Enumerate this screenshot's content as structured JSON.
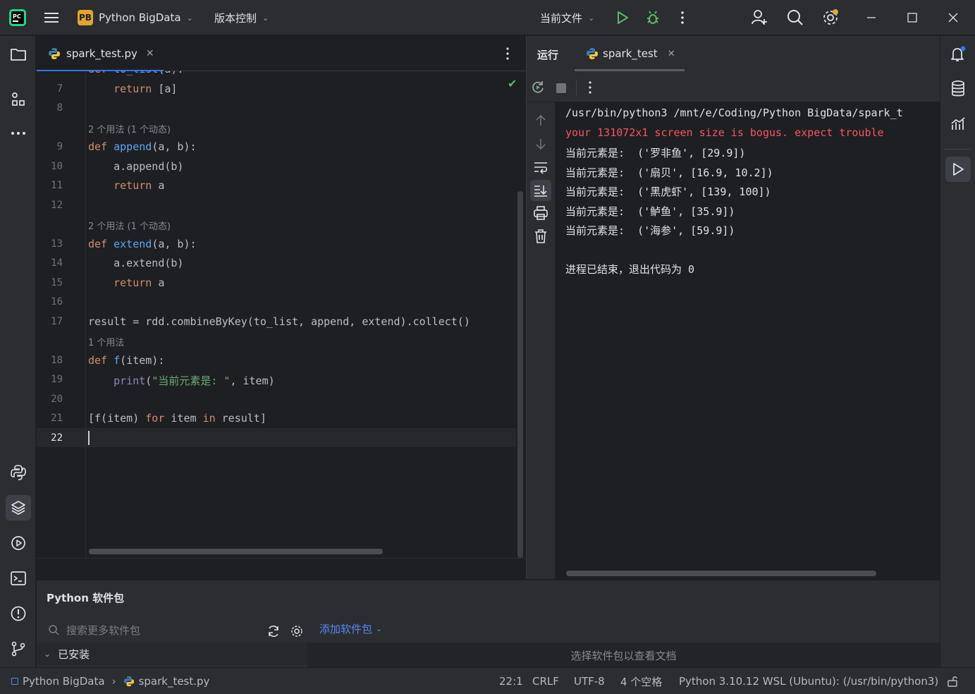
{
  "titlebar": {
    "project_badge": "PB",
    "project_name": "Python BigData",
    "vcs_menu": "版本控制",
    "run_config": "当前文件"
  },
  "editor": {
    "tab_label": "spark_test.py",
    "lines": [
      {
        "num": "7",
        "text": "    return [a]"
      },
      {
        "num": "8",
        "text": ""
      },
      {
        "hint": "2 个用法 (1 个动态)"
      },
      {
        "num": "9",
        "text": "def append(a, b):"
      },
      {
        "num": "10",
        "text": "    a.append(b)"
      },
      {
        "num": "11",
        "text": "    return a"
      },
      {
        "num": "12",
        "text": ""
      },
      {
        "hint": "2 个用法 (1 个动态)"
      },
      {
        "num": "13",
        "text": "def extend(a, b):"
      },
      {
        "num": "14",
        "text": "    a.extend(b)"
      },
      {
        "num": "15",
        "text": "    return a"
      },
      {
        "num": "16",
        "text": ""
      },
      {
        "num": "17",
        "text": "result = rdd.combineByKey(to_list, append, extend).collect()"
      },
      {
        "hint": "1 个用法"
      },
      {
        "num": "18",
        "text": "def f(item):"
      },
      {
        "num": "19",
        "text": "    print(\"当前元素是: \", item)"
      },
      {
        "num": "20",
        "text": ""
      },
      {
        "num": "21",
        "text": "[f(item) for item in result]"
      },
      {
        "num": "22",
        "text": ""
      }
    ],
    "code_tokens": {
      "l7_kw": "return",
      "l7_rest": " [a]",
      "l9_kw": "def",
      "l9_fn": "append",
      "l9_rest": "(a, b):",
      "l10": "a.append(b)",
      "l11_kw": "return",
      "l11_rest": " a",
      "l13_kw": "def",
      "l13_fn": "extend",
      "l13_rest": "(a, b):",
      "l14": "a.extend(b)",
      "l15_kw": "return",
      "l15_rest": " a",
      "l17": "result = rdd.combineByKey(to_list, append, extend).collect()",
      "l18_kw": "def",
      "l18_fn": "f",
      "l18_rest": "(item):",
      "l19_bi": "print",
      "l19_p1": "(",
      "l19_str": "\"当前元素是: \"",
      "l19_rest": ", item)",
      "l21_a": "[f(item) ",
      "l21_kw1": "for",
      "l21_b": " item ",
      "l21_kw2": "in",
      "l21_c": " result]",
      "hint_a": "2 个用法 (1 个动态)",
      "hint_b": "2 个用法 (1 个动态)",
      "hint_c": "1 个用法"
    }
  },
  "run": {
    "title": "运行",
    "tab_label": "spark_test",
    "console": [
      {
        "text": "/usr/bin/python3 /mnt/e/Coding/Python BigData/spark_t",
        "type": "normal"
      },
      {
        "text": "your 131072x1 screen size is bogus. expect trouble",
        "type": "err"
      },
      {
        "text": "当前元素是:  ('罗非鱼', [29.9])",
        "type": "normal"
      },
      {
        "text": "当前元素是:  ('扇贝', [16.9, 10.2])",
        "type": "normal"
      },
      {
        "text": "当前元素是:  ('黑虎虾', [139, 100])",
        "type": "normal"
      },
      {
        "text": "当前元素是:  ('鲈鱼', [35.9])",
        "type": "normal"
      },
      {
        "text": "当前元素是:  ('海参', [59.9])",
        "type": "normal"
      },
      {
        "text": "",
        "type": "normal"
      },
      {
        "text": "进程已结束，退出代码为 0",
        "type": "normal"
      }
    ]
  },
  "packages": {
    "title": "Python 软件包",
    "search_placeholder": "搜索更多软件包",
    "add_package": "添加软件包",
    "installed": "已安装",
    "doc_hint": "选择软件包以查看文档"
  },
  "statusbar": {
    "breadcrumb_project": "Python BigData",
    "breadcrumb_file": "spark_test.py",
    "position": "22:1",
    "line_sep": "CRLF",
    "encoding": "UTF-8",
    "indent": "4 个空格",
    "interpreter": "Python 3.10.12 WSL (Ubuntu): (/usr/bin/python3)"
  },
  "colors": {
    "accent": "#3574f0",
    "keyword": "#cf8e6d",
    "function": "#56a8f5",
    "string": "#6aab73",
    "error": "#f75464"
  }
}
